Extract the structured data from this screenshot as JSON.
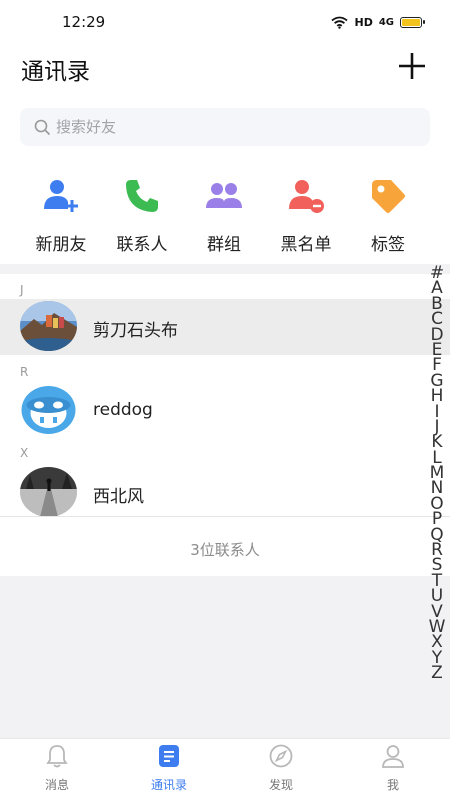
{
  "status_bar": {
    "time": "12:29",
    "network": "HD",
    "signal_text": "4G"
  },
  "header": {
    "title": "通讯录"
  },
  "search": {
    "placeholder": "搜索好友"
  },
  "quick_actions": [
    {
      "label": "新朋友",
      "icon": "add-user-icon",
      "color": "#3d7df0"
    },
    {
      "label": "联系人",
      "icon": "phone-icon",
      "color": "#3cbb52"
    },
    {
      "label": "群组",
      "icon": "group-icon",
      "color": "#9b7fe8"
    },
    {
      "label": "黑名单",
      "icon": "block-user-icon",
      "color": "#f1605a"
    },
    {
      "label": "标签",
      "icon": "tag-icon",
      "color": "#f7a43a"
    }
  ],
  "contacts": {
    "sections": [
      {
        "letter": "J",
        "name": "剪刀石头布",
        "avatar": "landscape-avatar"
      },
      {
        "letter": "R",
        "name": "reddog",
        "avatar": "mascot-avatar"
      },
      {
        "letter": "X",
        "name": "西北风",
        "avatar": "bw-photo-avatar"
      }
    ],
    "count_text": "3位联系人"
  },
  "alpha_index": [
    "#",
    "A",
    "B",
    "C",
    "D",
    "E",
    "F",
    "G",
    "H",
    "I",
    "J",
    "K",
    "L",
    "M",
    "N",
    "O",
    "P",
    "Q",
    "R",
    "S",
    "T",
    "U",
    "V",
    "W",
    "X",
    "Y",
    "Z"
  ],
  "tabbar": {
    "tabs": [
      {
        "label": "消息",
        "icon": "bell-icon",
        "active": false
      },
      {
        "label": "通讯录",
        "icon": "contacts-icon",
        "active": true
      },
      {
        "label": "发现",
        "icon": "compass-icon",
        "active": false
      },
      {
        "label": "我",
        "icon": "person-icon",
        "active": false
      }
    ]
  },
  "colors": {
    "accent": "#3d7df0",
    "highlight_row": "#ececec"
  }
}
